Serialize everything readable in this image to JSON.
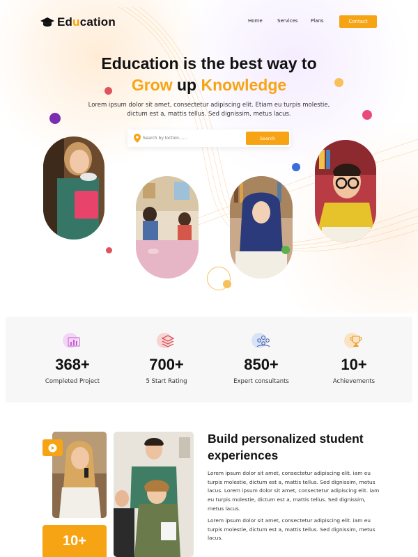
{
  "nav": {
    "logo_prefix": "Ed",
    "logo_highlight": "u",
    "logo_suffix": "cation",
    "links": [
      "Home",
      "Services",
      "Plans"
    ],
    "contact_label": "Contact"
  },
  "hero": {
    "headline_line1": "Education is the best way to",
    "headline_word1": "Grow",
    "headline_word2": " up ",
    "headline_word3": "Knowledge",
    "subtitle_line1": "Lorem ipsum dolor sit amet, consectetur adipiscing elit. Etiam eu turpis molestie,",
    "subtitle_line2": "dictum est a, mattis tellus. Sed dignissim, metus  lacus.",
    "search_placeholder": "Search by loction......",
    "search_button": "Search"
  },
  "stats": [
    {
      "value": "368+",
      "label": "Completed Project",
      "icon": "chart-icon"
    },
    {
      "value": "700+",
      "label": "5 Start Rating",
      "icon": "layers-icon"
    },
    {
      "value": "850+",
      "label": "Expert consultants",
      "icon": "team-icon"
    },
    {
      "value": "10+",
      "label": "Achievements",
      "icon": "trophy-icon"
    }
  ],
  "section": {
    "title_line1": "Build personalized student",
    "title_line2": "experiences",
    "para1": "Lorem ipsum dolor sit amet, consectetur adipiscing elit. iam eu turpis molestie, dictum est a, mattis tellus. Sed dignissim, metus lacus. Lorem ipsum dolor sit amet, consectetur adipiscing elit. iam eu turpis molestie, dictum est a, mattis tellus. Sed dignissim, metus  lacus.",
    "para2": "Lorem ipsum dolor sit amet, consectetur adipiscing elit. iam eu turpis molestie, dictum est a, mattis tellus. Sed dignissim, metus  lacus.",
    "counter": "10+"
  },
  "colors": {
    "accent": "#f7a414",
    "dot_red": "#e0525e",
    "dot_purple": "#7b2fb0",
    "dot_pink": "#e84b7a",
    "dot_blue": "#3a6fd8",
    "dot_yellow": "#f7c05a"
  }
}
